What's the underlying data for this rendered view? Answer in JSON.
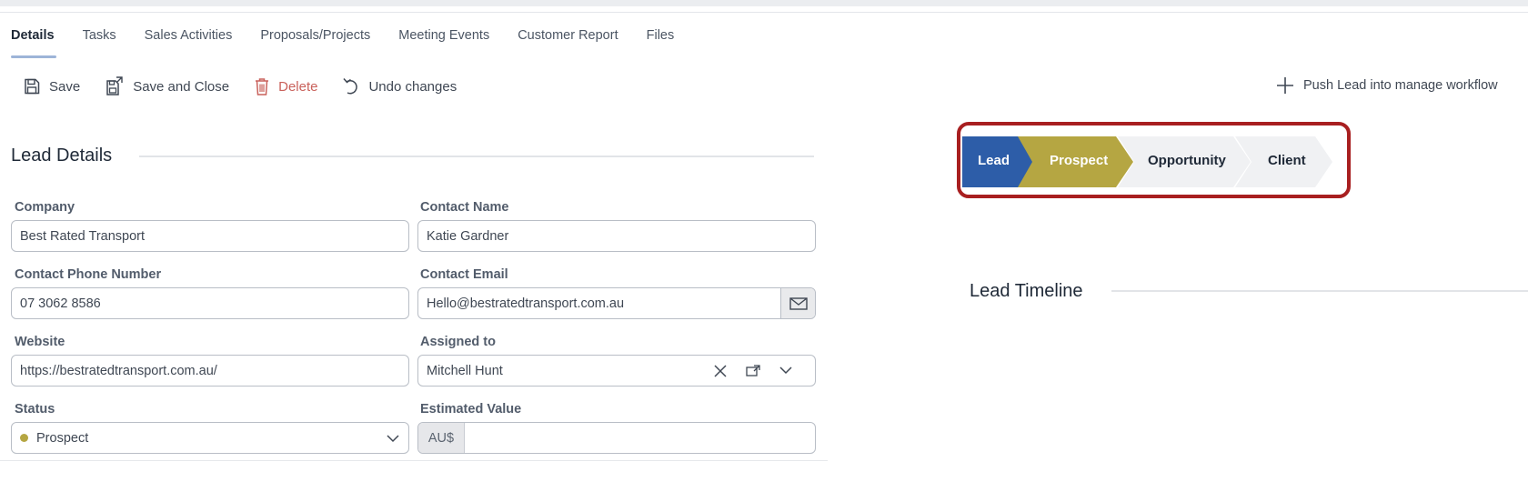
{
  "tabs": [
    {
      "label": "Details",
      "active": true
    },
    {
      "label": "Tasks"
    },
    {
      "label": "Sales Activities"
    },
    {
      "label": "Proposals/Projects"
    },
    {
      "label": "Meeting Events"
    },
    {
      "label": "Customer Report"
    },
    {
      "label": "Files"
    }
  ],
  "toolbar": {
    "save": "Save",
    "save_close": "Save and Close",
    "delete": "Delete",
    "undo": "Undo changes",
    "push": "Push Lead into manage workflow"
  },
  "lead_details": {
    "title": "Lead Details",
    "company": {
      "label": "Company",
      "value": "Best Rated Transport"
    },
    "contact_name": {
      "label": "Contact Name",
      "value": "Katie Gardner"
    },
    "phone": {
      "label": "Contact Phone Number",
      "value": "07 3062 8586"
    },
    "email": {
      "label": "Contact Email",
      "value": "Hello@bestratedtransport.com.au"
    },
    "website": {
      "label": "Website",
      "value": "https://bestratedtransport.com.au/"
    },
    "assigned": {
      "label": "Assigned to",
      "value": "Mitchell Hunt"
    },
    "status": {
      "label": "Status",
      "value": "Prospect",
      "dot_color": "#b5a642"
    },
    "estimated": {
      "label": "Estimated Value",
      "prefix": "AU$",
      "value": ""
    }
  },
  "pipeline": {
    "stages": [
      {
        "label": "Lead",
        "color": "#2d5da8",
        "text_color": "#ffffff"
      },
      {
        "label": "Prospect",
        "color": "#b5a642",
        "text_color": "#ffffff"
      },
      {
        "label": "Opportunity",
        "color": "#f0f1f3",
        "text_color": "#1f2937"
      },
      {
        "label": "Client",
        "color": "#f0f1f3",
        "text_color": "#1f2937"
      }
    ],
    "highlight_color": "#a81f20"
  },
  "timeline": {
    "title": "Lead Timeline"
  }
}
